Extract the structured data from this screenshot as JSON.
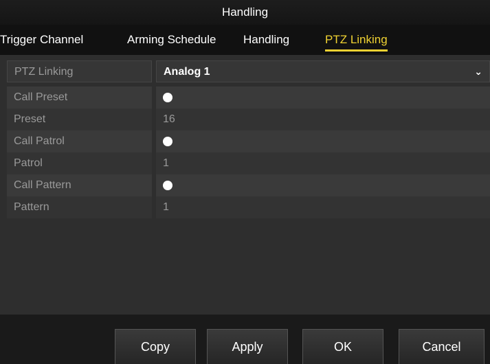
{
  "window": {
    "title": "Handling"
  },
  "tabs": [
    {
      "label": "Trigger Channel",
      "active": false
    },
    {
      "label": "Arming Schedule",
      "active": false
    },
    {
      "label": "Handling",
      "active": false
    },
    {
      "label": "PTZ Linking",
      "active": true
    }
  ],
  "form": {
    "ptz_linking": {
      "label": "PTZ Linking",
      "value": "Analog 1",
      "icon": "chevron-down-icon"
    },
    "call_preset": {
      "label": "Call Preset",
      "checked": true
    },
    "preset": {
      "label": "Preset",
      "value": "16"
    },
    "call_patrol": {
      "label": "Call Patrol",
      "checked": true
    },
    "patrol": {
      "label": "Patrol",
      "value": "1"
    },
    "call_pattern": {
      "label": "Call Pattern",
      "checked": true
    },
    "pattern": {
      "label": "Pattern",
      "value": "1"
    }
  },
  "buttons": {
    "copy": "Copy",
    "apply": "Apply",
    "ok": "OK",
    "cancel": "Cancel"
  },
  "colors": {
    "active_tab": "#f0d232",
    "title_bar": "#1a1a1a",
    "panel": "#2e2e2e"
  }
}
